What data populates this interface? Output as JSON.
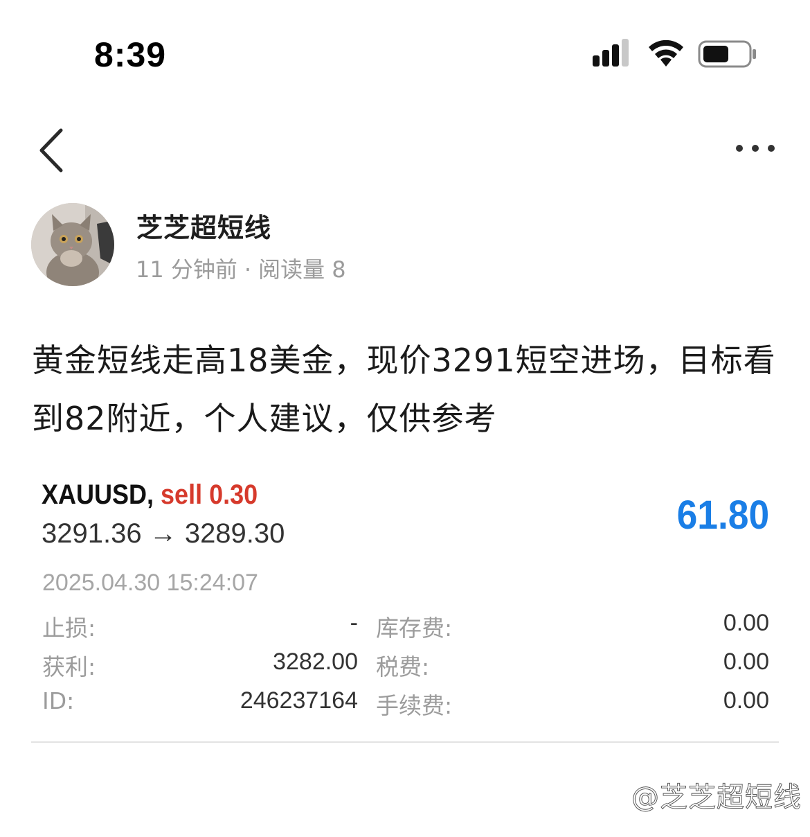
{
  "status_bar": {
    "time": "8:39"
  },
  "nav": {
    "back_icon": "chevron-left-icon",
    "more_icon": "more-horizontal-icon"
  },
  "author": {
    "name": "芝芝超短线",
    "time_ago": "11 分钟前",
    "separator": "·",
    "read_count": "阅读量 8"
  },
  "post": {
    "text": "黄金短线走高18美金，现价3291短空进场，目标看到82附近，个人建议，仅供参考"
  },
  "trade": {
    "symbol": "XAUUSD,",
    "side": "sell 0.30",
    "price_range": "3291.36 → 3289.30",
    "profit": "61.80",
    "date": "2025.04.30 15:24:07",
    "details": [
      {
        "label": "止损:",
        "value": "-",
        "label2": "库存费:",
        "value2": "0.00"
      },
      {
        "label": "获利:",
        "value": "3282.00",
        "label2": "税费:",
        "value2": "0.00"
      },
      {
        "label": "ID:",
        "value": "246237164",
        "label2": "手续费:",
        "value2": "0.00"
      }
    ],
    "colors": {
      "sell": "#d63a2c",
      "profit": "#1a7ee6"
    }
  },
  "watermark": "@芝芝超短线"
}
